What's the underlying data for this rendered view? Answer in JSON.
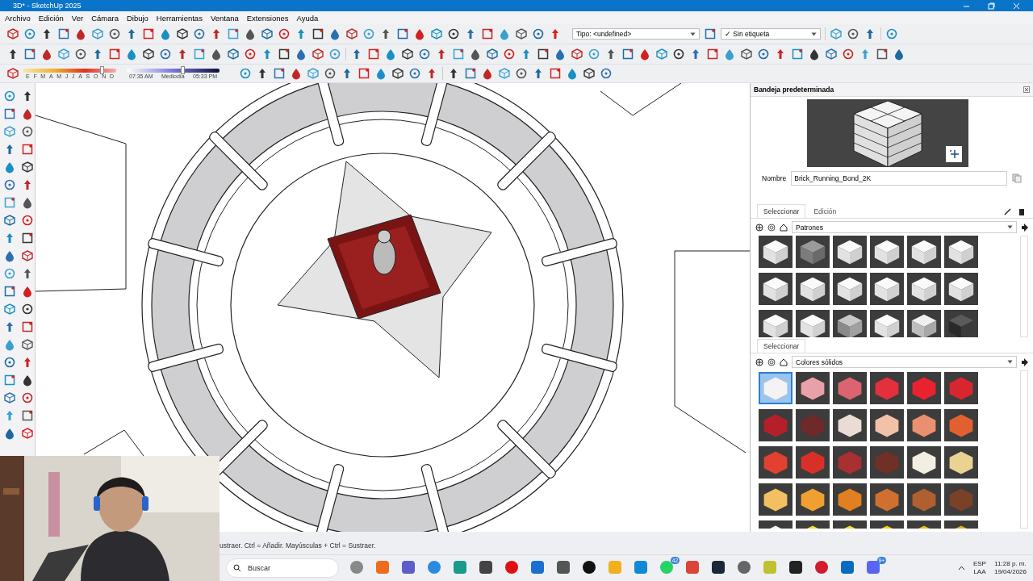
{
  "window": {
    "title": "3D* - SketchUp 2025"
  },
  "menu": [
    "Archivo",
    "Edición",
    "Ver",
    "Cámara",
    "Dibujo",
    "Herramientas",
    "Ventana",
    "Extensiones",
    "Ayuda"
  ],
  "toolbar": {
    "type_dropdown": "Tipo: <undefined>",
    "tag_dropdown": {
      "check": "✓",
      "label": "Sin etiqueta"
    }
  },
  "shadows": {
    "months": [
      "E",
      "F",
      "M",
      "A",
      "M",
      "J",
      "J",
      "A",
      "S",
      "O",
      "N",
      "D"
    ],
    "month_slider": {
      "level": 0.84
    },
    "time_slider": {
      "level": 0.6
    },
    "start_time": "07:35 AM",
    "mid_time": "Mediodía",
    "end_time": "05:33 PM"
  },
  "tray": {
    "title": "Bandeja predeterminada",
    "name_label": "Nombre",
    "name_value": "Brick_Running_Bond_2K",
    "tabs": [
      {
        "label": "Seleccionar",
        "selected": true
      },
      {
        "label": "Edición",
        "selected": false
      }
    ],
    "library": "Patrones",
    "patterns": [
      {
        "kind": "brick"
      },
      {
        "kind": "stone"
      },
      {
        "kind": "brick"
      },
      {
        "kind": "brick"
      },
      {
        "kind": "brick"
      },
      {
        "kind": "brick"
      },
      {
        "kind": "brick"
      },
      {
        "kind": "brick"
      },
      {
        "kind": "brick"
      },
      {
        "kind": "brick"
      },
      {
        "kind": "brick"
      },
      {
        "kind": "brick"
      },
      {
        "kind": "brick"
      },
      {
        "kind": "brick"
      },
      {
        "kind": "marble"
      },
      {
        "kind": "brick"
      },
      {
        "kind": "speckle"
      },
      {
        "kind": "dark"
      }
    ],
    "second_tab": "Seleccionar",
    "second_library": "Colores sólidos",
    "colors": [
      {
        "color": "#f4f2f2",
        "selected": true
      },
      {
        "color": "#eaa0a8",
        "selected": false
      },
      {
        "color": "#dc6470",
        "selected": false
      },
      {
        "color": "#e3303c",
        "selected": false
      },
      {
        "color": "#e8232f",
        "selected": false
      },
      {
        "color": "#d8262e",
        "selected": false
      },
      {
        "color": "#b3202a",
        "selected": false
      },
      {
        "color": "#6e2a2a",
        "selected": false
      },
      {
        "color": "#eadcd4",
        "selected": false
      },
      {
        "color": "#f2c2a8",
        "selected": false
      },
      {
        "color": "#ea9070",
        "selected": false
      },
      {
        "color": "#e26030",
        "selected": false
      },
      {
        "color": "#e24030",
        "selected": false
      },
      {
        "color": "#d83028",
        "selected": false
      },
      {
        "color": "#a83030",
        "selected": false
      },
      {
        "color": "#703028",
        "selected": false
      },
      {
        "color": "#f2eee2",
        "selected": false
      },
      {
        "color": "#ead292",
        "selected": false
      },
      {
        "color": "#f2c060",
        "selected": false
      },
      {
        "color": "#f0a030",
        "selected": false
      },
      {
        "color": "#e08020",
        "selected": false
      },
      {
        "color": "#d07030",
        "selected": false
      },
      {
        "color": "#b06030",
        "selected": false
      },
      {
        "color": "#7a4028",
        "selected": false
      },
      {
        "color": "#f2f2f2",
        "selected": false
      },
      {
        "color": "#f2e020",
        "selected": false
      },
      {
        "color": "#f0e024",
        "selected": false
      },
      {
        "color": "#f0d010",
        "selected": false
      },
      {
        "color": "#e8c010",
        "selected": false
      },
      {
        "color": "#e0b012",
        "selected": false
      }
    ]
  },
  "status_bar": "ustraer. Ctrl = Añadir. Mayúsculas + Ctrl = Sustraer.",
  "taskbar": {
    "search": "Buscar",
    "whatsapp_badge": "42",
    "discord_badge": "9+",
    "lang": "ESP",
    "region": "LAA",
    "time": "11:28 p. m.",
    "date": "19/04/2026"
  }
}
